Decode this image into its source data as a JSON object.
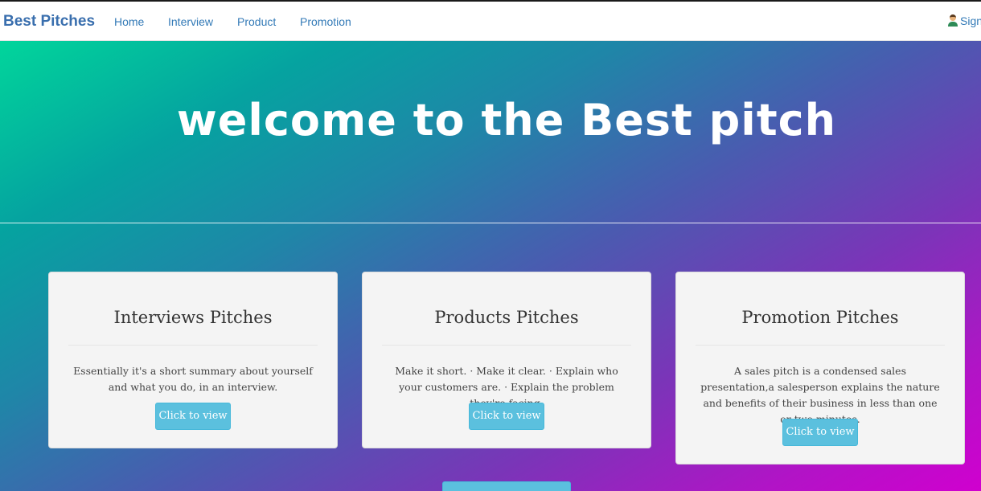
{
  "nav": {
    "brand": "Best Pitches",
    "links": [
      "Home",
      "Interview",
      "Product",
      "Promotion"
    ],
    "signin_label": "Sign"
  },
  "hero": {
    "title": "welcome to the Best pitch"
  },
  "cards": [
    {
      "title": "Interviews Pitches",
      "text": "Essentially it's a short summary about yourself and what you do, in an interview.",
      "button": "Click to view"
    },
    {
      "title": "Products Pitches",
      "text": "Make it short. · Make it clear. · Explain who your customers are. · Explain the problem they're facing.",
      "button": "Click to view"
    },
    {
      "title": "Promotion Pitches",
      "text": "A sales pitch is a condensed sales presentation,a salesperson explains the nature and benefits of their business in less than one or two minutes.",
      "button": "Click to view"
    }
  ],
  "colors": {
    "brand": "#3a6fae",
    "link": "#337ab7",
    "button": "#5bc0de",
    "gradient_start": "#00e09a",
    "gradient_end": "#d000cf"
  },
  "icons": {
    "signin": "person-icon"
  }
}
